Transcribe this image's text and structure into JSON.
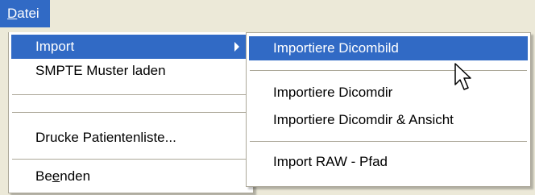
{
  "menubar": {
    "datei": {
      "mnemonic": "D",
      "rest": "atei"
    }
  },
  "main_menu": {
    "import": "Import",
    "smpte": "SMPTE Muster laden",
    "drucke": "Drucke Patientenliste...",
    "beenden": {
      "before": "Be",
      "mnemonic": "e",
      "after": "nden"
    }
  },
  "sub_menu": {
    "items": [
      "Importiere Dicombild",
      "Importiere Dicomdir",
      "Importiere Dicomdir & Ansicht",
      "Import RAW - Pfad"
    ]
  },
  "icons": {
    "submenu_arrow": "chevron-right-icon",
    "cursor": "mouse-pointer-icon"
  },
  "colors": {
    "highlight": "#316ac5",
    "background": "#ece9d8"
  }
}
